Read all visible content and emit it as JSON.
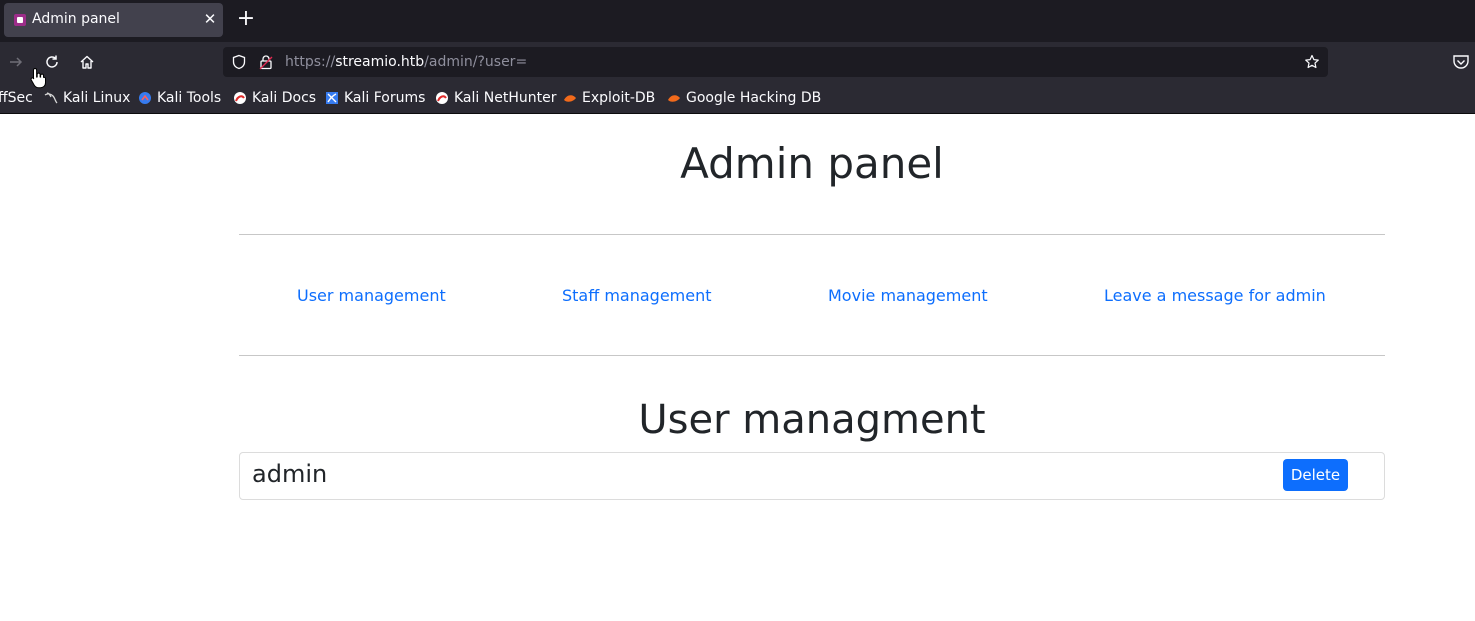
{
  "browser": {
    "tab_title": "Admin panel",
    "url_scheme": "https://",
    "url_host": "streamio.htb",
    "url_path": "/admin/?user=",
    "bookmarks": [
      {
        "label": "ffSec",
        "icon": "offsec-icon"
      },
      {
        "label": "Kali Linux",
        "icon": "kali-dragon-icon"
      },
      {
        "label": "Kali Tools",
        "icon": "kali-tools-icon"
      },
      {
        "label": "Kali Docs",
        "icon": "kali-docs-icon"
      },
      {
        "label": "Kali Forums",
        "icon": "kali-forums-icon"
      },
      {
        "label": "Kali NetHunter",
        "icon": "kali-nethunter-icon"
      },
      {
        "label": "Exploit-DB",
        "icon": "exploit-db-icon"
      },
      {
        "label": "Google Hacking DB",
        "icon": "ghdb-icon"
      }
    ]
  },
  "page": {
    "title": "Admin panel",
    "nav": [
      {
        "label": "User management"
      },
      {
        "label": "Staff management"
      },
      {
        "label": "Movie management"
      },
      {
        "label": "Leave a message for admin"
      }
    ],
    "section_title": "User managment",
    "users": [
      {
        "name": "admin",
        "action_label": "Delete"
      }
    ]
  },
  "colors": {
    "link": "#0d6efd",
    "button": "#0d6efd",
    "chrome_dark": "#1c1b22",
    "chrome_toolbar": "#2b2a33"
  }
}
